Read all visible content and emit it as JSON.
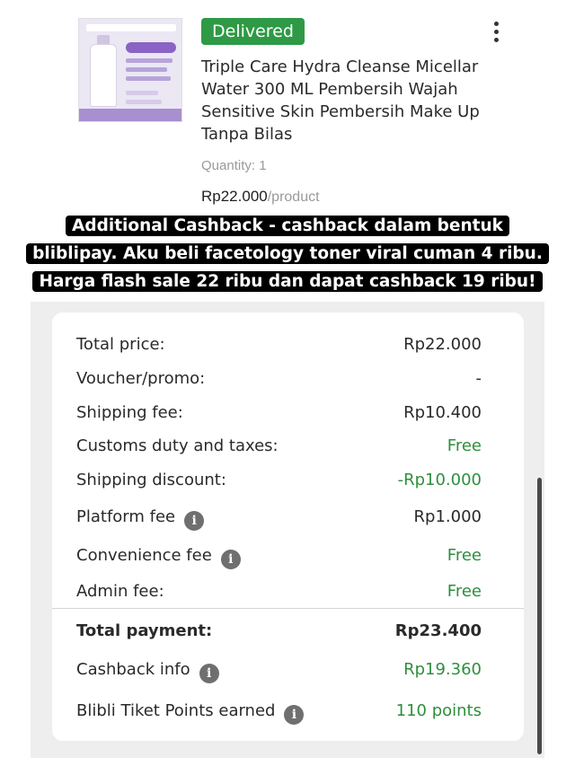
{
  "order": {
    "status": "Delivered",
    "product_name_lines": [
      "Triple Care Hydra Cleanse Micellar",
      "Water 300 ML Pembersih Wajah",
      "Sensitive Skin Pembersih Make Up",
      "Tanpa Bilas"
    ],
    "quantity": "Quantity: 1",
    "price": "Rp22.000",
    "price_unit": "/product",
    "more_icon": "more-vertical-icon",
    "status_color": "#2e9a45"
  },
  "caption": {
    "lines": [
      "Additional Cashback - cashback dalam bentuk",
      "bliblipay. Aku beli facetology toner viral cuman 4 ribu.",
      "Harga flash sale 22 ribu dan dapat cashback 19 ribu!"
    ]
  },
  "summary": {
    "rows": [
      {
        "label": "Total price:",
        "value": "Rp22.000"
      },
      {
        "label": "Voucher/promo:",
        "value": "-"
      },
      {
        "label": "Shipping fee:",
        "value": "Rp10.400"
      },
      {
        "label": "Customs duty and taxes:",
        "value": "Free"
      },
      {
        "label": "Shipping discount:",
        "value": "-Rp10.000"
      },
      {
        "label": "Platform fee",
        "value": "Rp1.000"
      },
      {
        "label": "Convenience fee",
        "value": "Free"
      },
      {
        "label": "Admin fee:",
        "value": "Free"
      }
    ],
    "total": {
      "label": "Total payment:",
      "value": "Rp23.400"
    },
    "cashback": {
      "label": "Cashback info",
      "value": "Rp19.360"
    },
    "points": {
      "label": "Blibli Tiket Points earned",
      "value": "110 points"
    },
    "info_icon": "info-icon",
    "green_color": "#2e8f3e"
  }
}
